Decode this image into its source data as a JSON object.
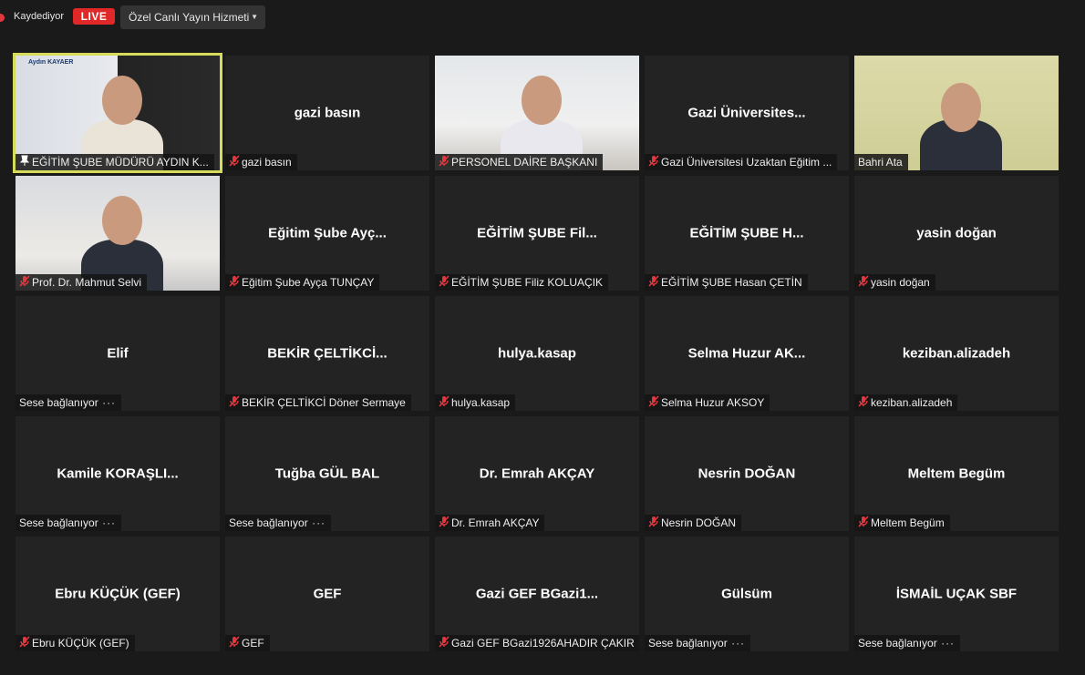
{
  "topbar": {
    "recording_label": "Kaydediyor",
    "live_label": "LIVE",
    "service_label": "Özel Canlı Yayın Hizmeti"
  },
  "tiles": [
    {
      "center": "",
      "label": "EĞİTİM ŞUBE MÜDÜRÜ AYDIN K...",
      "video": true,
      "banner": "Aydın KAYAER"
    },
    {
      "center": "gazi basın",
      "label": "gazi basın"
    },
    {
      "center": "",
      "label": "PERSONEL DAİRE BAŞKANI",
      "video": true
    },
    {
      "center": "Gazi Üniversites...",
      "label": "Gazi Üniversitesi Uzaktan Eğitim ..."
    },
    {
      "center": "",
      "label": "Bahri Ata",
      "video": true
    },
    {
      "center": "",
      "label": "Prof. Dr. Mahmut Selvi",
      "video": true
    },
    {
      "center": "Eğitim Şube Ayç...",
      "label": "Eğitim Şube Ayça TUNÇAY"
    },
    {
      "center": "EĞİTİM ŞUBE Fil...",
      "label": "EĞİTİM ŞUBE Filiz KOLUAÇIK"
    },
    {
      "center": "EĞİTİM ŞUBE H...",
      "label": "EĞİTİM ŞUBE Hasan ÇETİN"
    },
    {
      "center": "yasin doğan",
      "label": "yasin doğan"
    },
    {
      "center": "Elif",
      "label": "Sese bağlanıyor",
      "connecting": true
    },
    {
      "center": "BEKİR ÇELTİKCİ...",
      "label": "BEKİR ÇELTİKCİ Döner Sermaye"
    },
    {
      "center": "hulya.kasap",
      "label": "hulya.kasap"
    },
    {
      "center": "Selma Huzur AK...",
      "label": "Selma Huzur AKSOY"
    },
    {
      "center": "keziban.alizadeh",
      "label": "keziban.alizadeh"
    },
    {
      "center": "Kamile KORAŞLI...",
      "label": "Sese bağlanıyor",
      "connecting": true
    },
    {
      "center": "Tuğba GÜL BAL",
      "label": "Sese bağlanıyor",
      "connecting": true
    },
    {
      "center": "Dr. Emrah AKÇAY",
      "label": "Dr. Emrah AKÇAY"
    },
    {
      "center": "Nesrin DOĞAN",
      "label": "Nesrin DOĞAN"
    },
    {
      "center": "Meltem Begüm",
      "label": "Meltem Begüm"
    },
    {
      "center": "Ebru KÜÇÜK (GEF)",
      "label": "Ebru KÜÇÜK (GEF)"
    },
    {
      "center": "GEF",
      "label": "GEF"
    },
    {
      "center": "Gazi GEF BGazi1...",
      "label": "Gazi GEF BGazi1926AHADIR ÇAKIR"
    },
    {
      "center": "Gülsüm",
      "label": "Sese bağlanıyor",
      "connecting": true
    },
    {
      "center": "İSMAİL UÇAK SBF",
      "label": "Sese bağlanıyor",
      "connecting": true
    }
  ],
  "colors": {
    "active_outline": "#d6dc59",
    "muted_icon": "#e0383e",
    "live": "#e02828"
  }
}
